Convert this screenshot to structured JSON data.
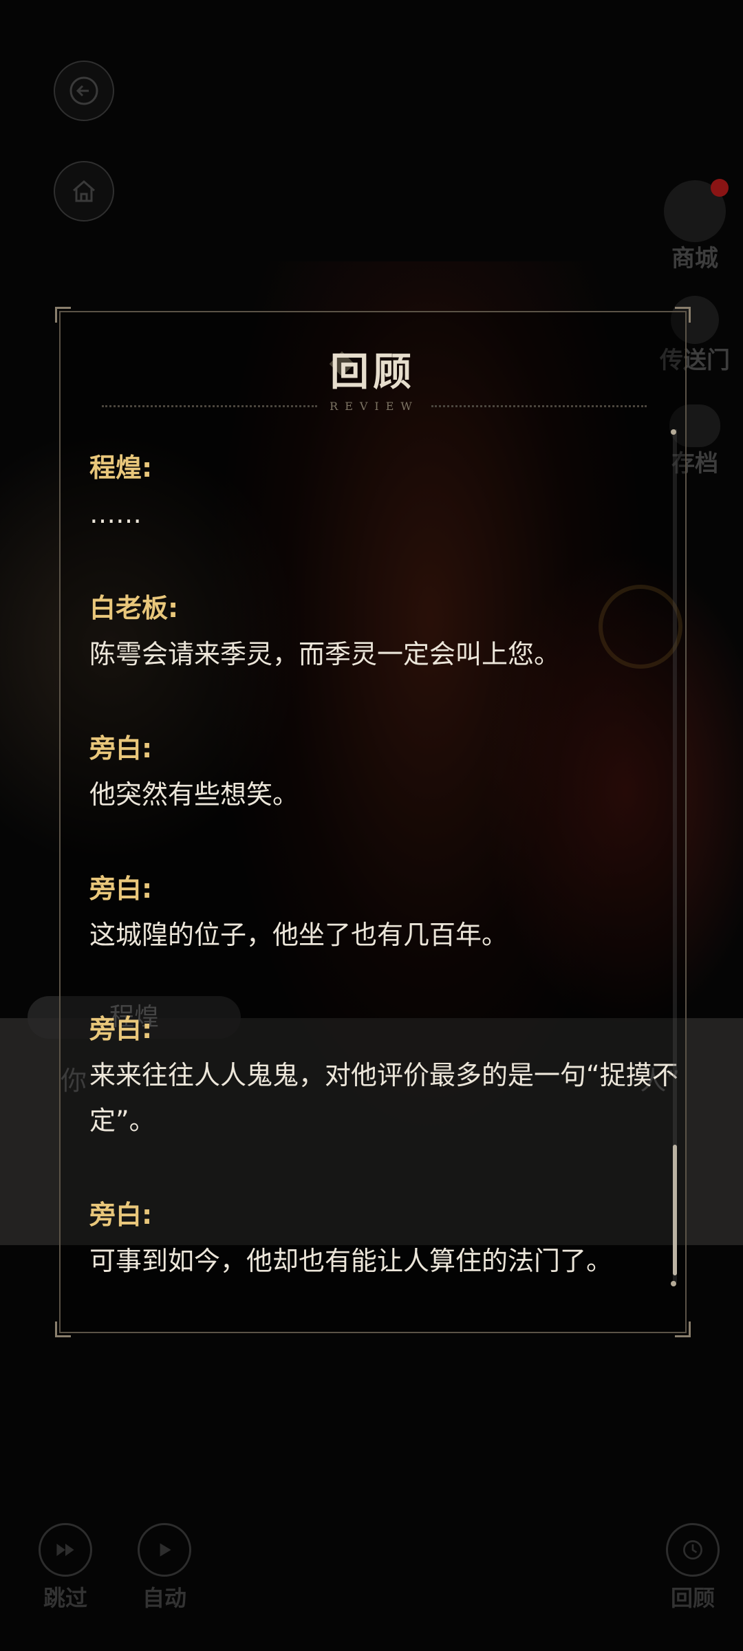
{
  "background": {
    "speaker_name": "程煌",
    "line_left": "你",
    "line_right": "人”"
  },
  "left_buttons": {
    "back": "back-arrow-icon",
    "home": "home-icon"
  },
  "side_menu": [
    {
      "label": "商城",
      "icon": "shop-character-icon",
      "badge": true
    },
    {
      "label": "传送门",
      "icon": "portal-icon"
    },
    {
      "label": "存档",
      "icon": "cloud-save-icon"
    }
  ],
  "bottom_controls": {
    "skip": "跳过",
    "auto": "自动",
    "review": "回顾"
  },
  "dialog": {
    "title": "回顾",
    "subtitle": "REVIEW",
    "entries": [
      {
        "speaker": "程煌:",
        "text": "……"
      },
      {
        "speaker": "白老板:",
        "text": "陈雩会请来季灵，而季灵一定会叫上您。"
      },
      {
        "speaker": "旁白:",
        "text": "他突然有些想笑。"
      },
      {
        "speaker": "旁白:",
        "text": "这城隍的位子，他坐了也有几百年。"
      },
      {
        "speaker": "旁白:",
        "text": "来来往往人人鬼鬼，对他评价最多的是一句“捉摸不定”。"
      },
      {
        "speaker": "旁白:",
        "text": "可事到如今，他却也有能让人算住的法门了。"
      }
    ]
  },
  "colors": {
    "speaker": "#e9c77b",
    "text": "#ece6da",
    "frame": "#5b5347"
  }
}
